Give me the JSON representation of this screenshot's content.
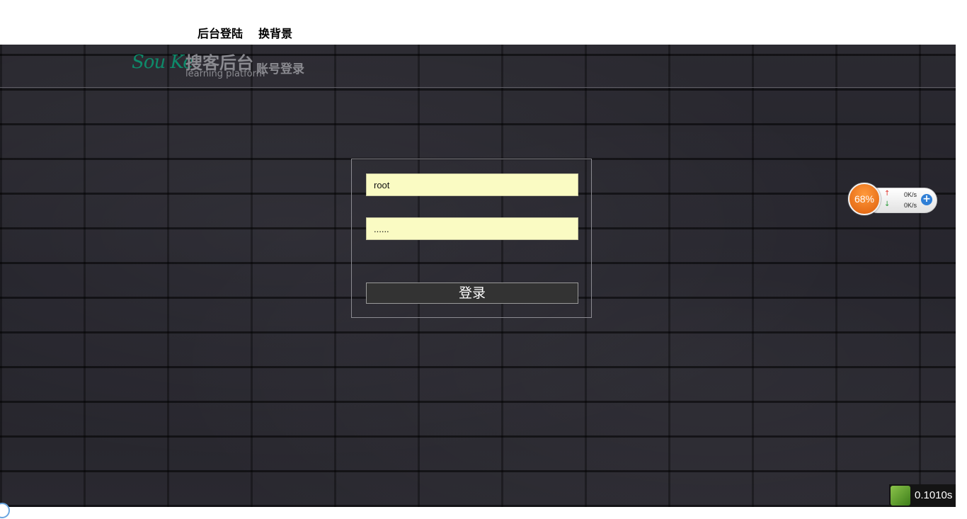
{
  "nav": {
    "admin_login": "后台登陆",
    "change_background": "换背景"
  },
  "logo": {
    "mark": "Sou Ke",
    "title": "搜客后台",
    "subtitle": "learning platform",
    "account_login": "账号登录"
  },
  "login": {
    "username_value": "root",
    "password_value": "......",
    "submit_label": "登录"
  },
  "net_monitor": {
    "percent": "68%",
    "upload": "0K/s",
    "download": "0K/s"
  },
  "timer": {
    "value": "0.1010s"
  },
  "colors": {
    "input_bg": "#fafbc3",
    "button_bg": "#333333",
    "logo_green": "#0e8a6a",
    "ball_orange": "#e8701a"
  }
}
